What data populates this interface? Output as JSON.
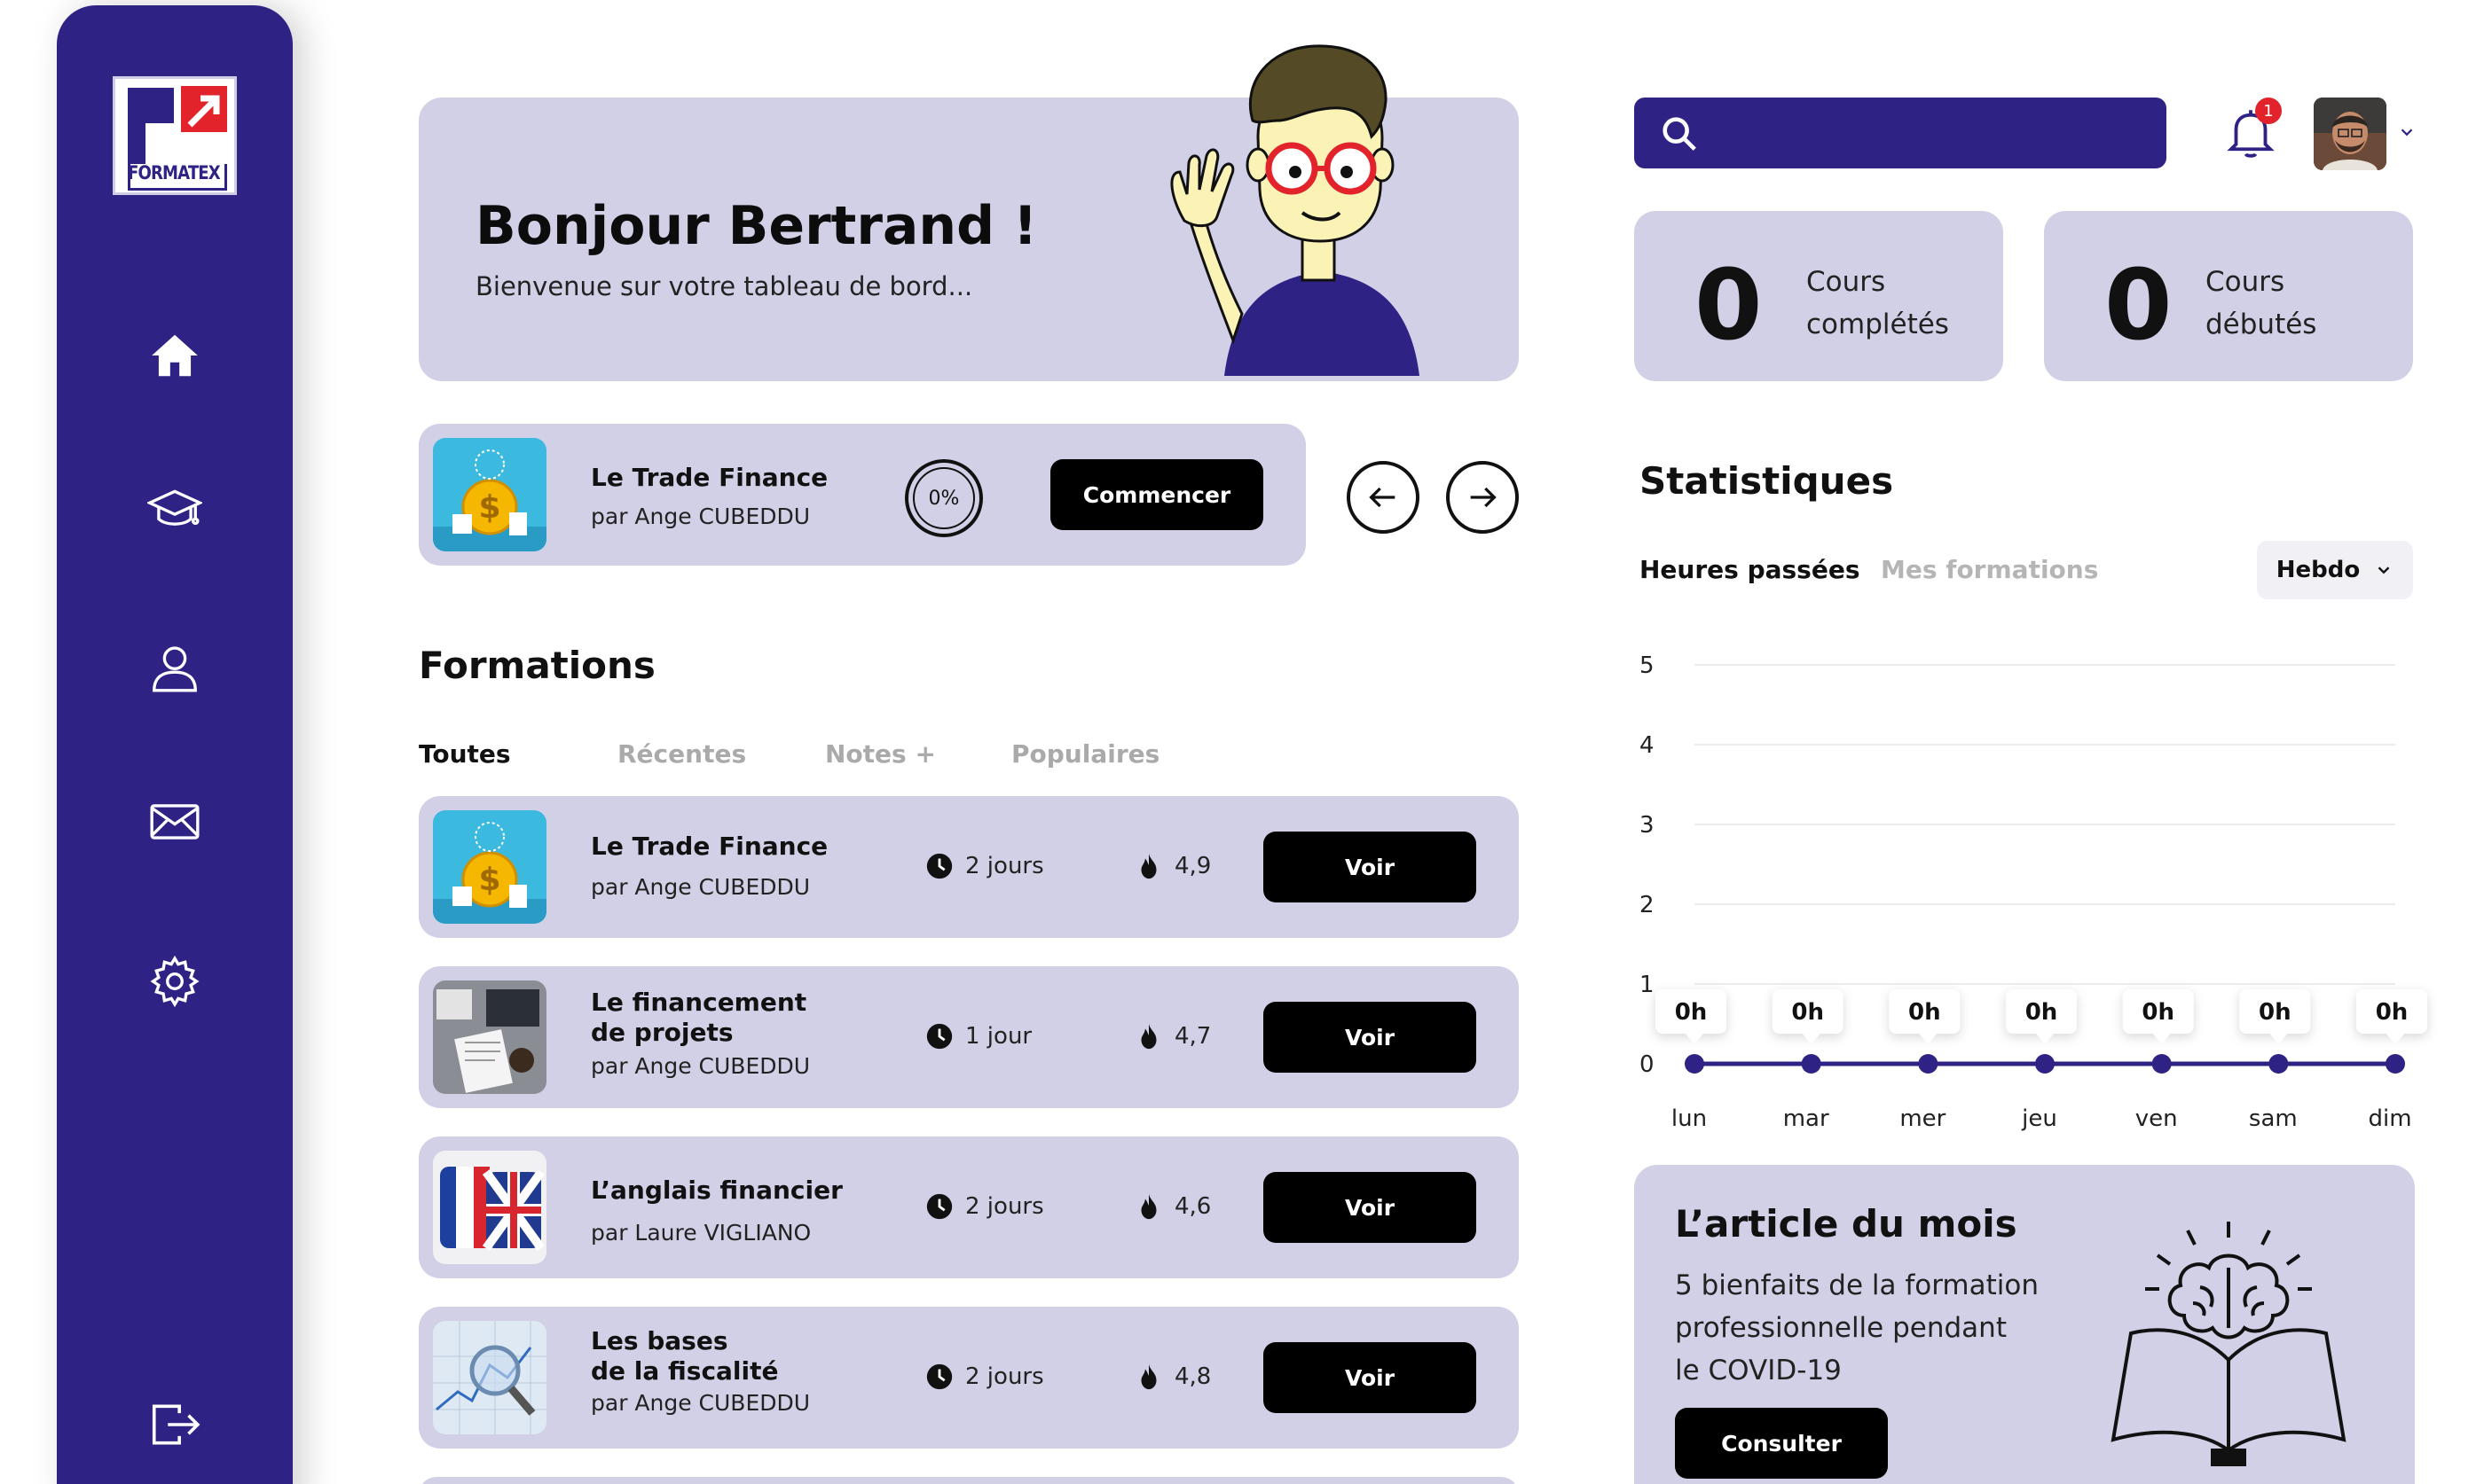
{
  "brand": {
    "logo_text": "FORMATEX",
    "primary": "#2e2384",
    "panel": "#d2d0e6",
    "accent_red": "#e3232b"
  },
  "sidebar": {
    "items": [
      {
        "icon": "home-icon"
      },
      {
        "icon": "graduation-cap-icon"
      },
      {
        "icon": "user-icon"
      },
      {
        "icon": "mail-icon"
      },
      {
        "icon": "gear-icon"
      },
      {
        "icon": "logout-icon"
      }
    ]
  },
  "hero": {
    "greeting": "Bonjour Bertrand !",
    "subtitle": "Bienvenue sur votre tableau de bord..."
  },
  "current_course": {
    "title": "Le Trade Finance",
    "author": "par Ange CUBEDDU",
    "progress_label": "0%",
    "progress": 0,
    "button": "Commencer"
  },
  "formations": {
    "title": "Formations",
    "tabs": [
      "Toutes",
      "Récentes",
      "Notes +",
      "Populaires"
    ],
    "active_tab": 0,
    "rows": [
      {
        "title": "Le Trade Finance",
        "author": "par Ange CUBEDDU",
        "duration": "2 jours",
        "rating": "4,9",
        "button": "Voir",
        "thumb": "finance"
      },
      {
        "title": "Le financement\nde projets",
        "author": "par Ange CUBEDDU",
        "duration": "1 jour",
        "rating": "4,7",
        "button": "Voir",
        "thumb": "desk"
      },
      {
        "title": "L’anglais financier",
        "author": "par Laure VIGLIANO",
        "duration": "2 jours",
        "rating": "4,6",
        "button": "Voir",
        "thumb": "flags"
      },
      {
        "title": "Les bases\nde la fiscalité",
        "author": "par Ange CUBEDDU",
        "duration": "2 jours",
        "rating": "4,8",
        "button": "Voir",
        "thumb": "graph"
      }
    ]
  },
  "search": {
    "placeholder": ""
  },
  "notifications": {
    "count": "1"
  },
  "stats_cards": [
    {
      "value": "0",
      "label": "Cours\ncomplétés"
    },
    {
      "value": "0",
      "label": "Cours\ndébutés"
    }
  ],
  "statistics": {
    "title": "Statistiques",
    "tabs": [
      "Heures passées",
      "Mes formations"
    ],
    "active_tab": 0,
    "period": "Hebdo"
  },
  "chart_data": {
    "type": "line",
    "categories": [
      "lun",
      "mar",
      "mer",
      "jeu",
      "ven",
      "sam",
      "dim"
    ],
    "values": [
      0,
      0,
      0,
      0,
      0,
      0,
      0
    ],
    "data_labels": [
      "0h",
      "0h",
      "0h",
      "0h",
      "0h",
      "0h",
      "0h"
    ],
    "yticks": [
      "0",
      "1",
      "2",
      "3",
      "4",
      "5"
    ],
    "ylim": [
      0,
      5
    ],
    "grid": true,
    "line_color": "#2e2384"
  },
  "article": {
    "title": "L’article du mois",
    "text": "5 bienfaits de la formation\nprofessionnelle pendant\nle COVID-19",
    "button": "Consulter"
  }
}
